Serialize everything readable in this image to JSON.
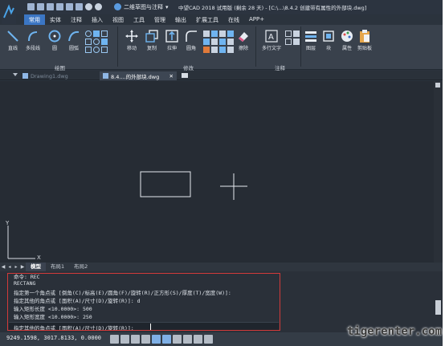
{
  "window": {
    "workspace": "二维草图与注释",
    "title": "中望CAD 2018 试用版 (剩余 28 天) - [C:\\...\\8.4.2  创建带有属性的外部块.dwg]"
  },
  "menu_tabs": [
    "常用",
    "实体",
    "注释",
    "插入",
    "视图",
    "工具",
    "管理",
    "输出",
    "扩展工具",
    "在线",
    "APP+"
  ],
  "ribbon": {
    "draw_tools": [
      "直线",
      "多段线",
      "圆",
      "圆弧"
    ],
    "modify_tools": [
      "移动",
      "复制",
      "拉伸",
      "圆角",
      "擦除"
    ],
    "annotation_tools": [
      "多行文字"
    ],
    "other_tools": [
      "图层",
      "块",
      "属性",
      "剪贴板"
    ],
    "groups": [
      "绘图",
      "修改",
      "注释"
    ]
  },
  "doc_tabs": {
    "inactive": "Drawing1.dwg",
    "active": "8.4....的外部块.dwg"
  },
  "layout_tabs": [
    "模型",
    "布局1",
    "布局2"
  ],
  "command": {
    "lines": [
      "命令: REC",
      "RECTANG",
      "指定第一个角点或 [倒角(C)/标高(E)/圆角(F)/旋转(R)/正方形(S)/厚度(T)/宽度(W)]:",
      "指定其他的角点或 [面积(A)/尺寸(D)/旋转(R)]: d",
      "输入矩形长度 <10.0000>: 500",
      "输入矩形宽度 <10.0000>: 250"
    ],
    "prompt": "指定其他的角点或 [面积(A)/尺寸(D)/旋转(R)]:"
  },
  "status": {
    "coordinates": "9249.1598, 3017.8133, 0.0000"
  },
  "axes": {
    "x": "X",
    "y": "Y"
  },
  "watermark": "tigerenter.com",
  "colors": {
    "accent": "#3b76c4",
    "highlight_box": "#d23a3a",
    "canvas": "#262c34"
  }
}
